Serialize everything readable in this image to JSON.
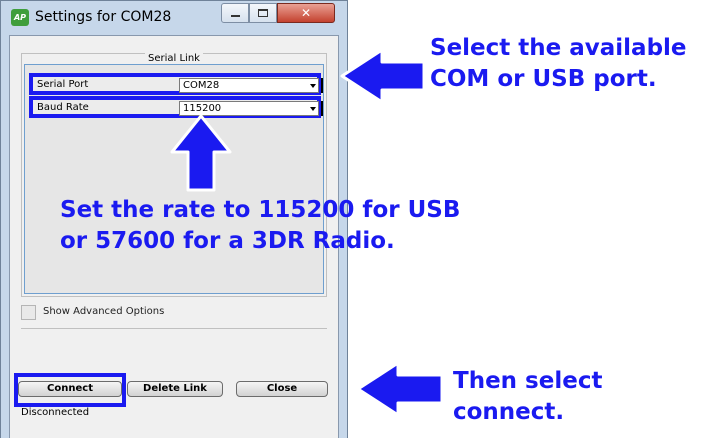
{
  "window": {
    "title": "Settings for COM28",
    "app_icon_text": "AP",
    "controls": {
      "minimize": "minimize-icon",
      "maximize": "maximize-icon",
      "close": "✕"
    }
  },
  "serial_link": {
    "group_title": "Serial Link",
    "serial_port": {
      "label": "Serial Port",
      "value": "COM28"
    },
    "baud_rate": {
      "label": "Baud Rate",
      "value": "115200"
    }
  },
  "advanced": {
    "label": "Show Advanced Options",
    "checked": false
  },
  "buttons": {
    "connect": "Connect",
    "delete_link": "Delete Link",
    "close": "Close"
  },
  "status": "Disconnected",
  "annotations": {
    "top_line1": "Select the available",
    "top_line2": "COM or USB port.",
    "mid_line1": "Set the rate to 115200 for USB",
    "mid_line2": "or 57600 for a 3DR Radio.",
    "bottom_line1": "Then select",
    "bottom_line2": "connect.",
    "color": "#1a1af0"
  }
}
